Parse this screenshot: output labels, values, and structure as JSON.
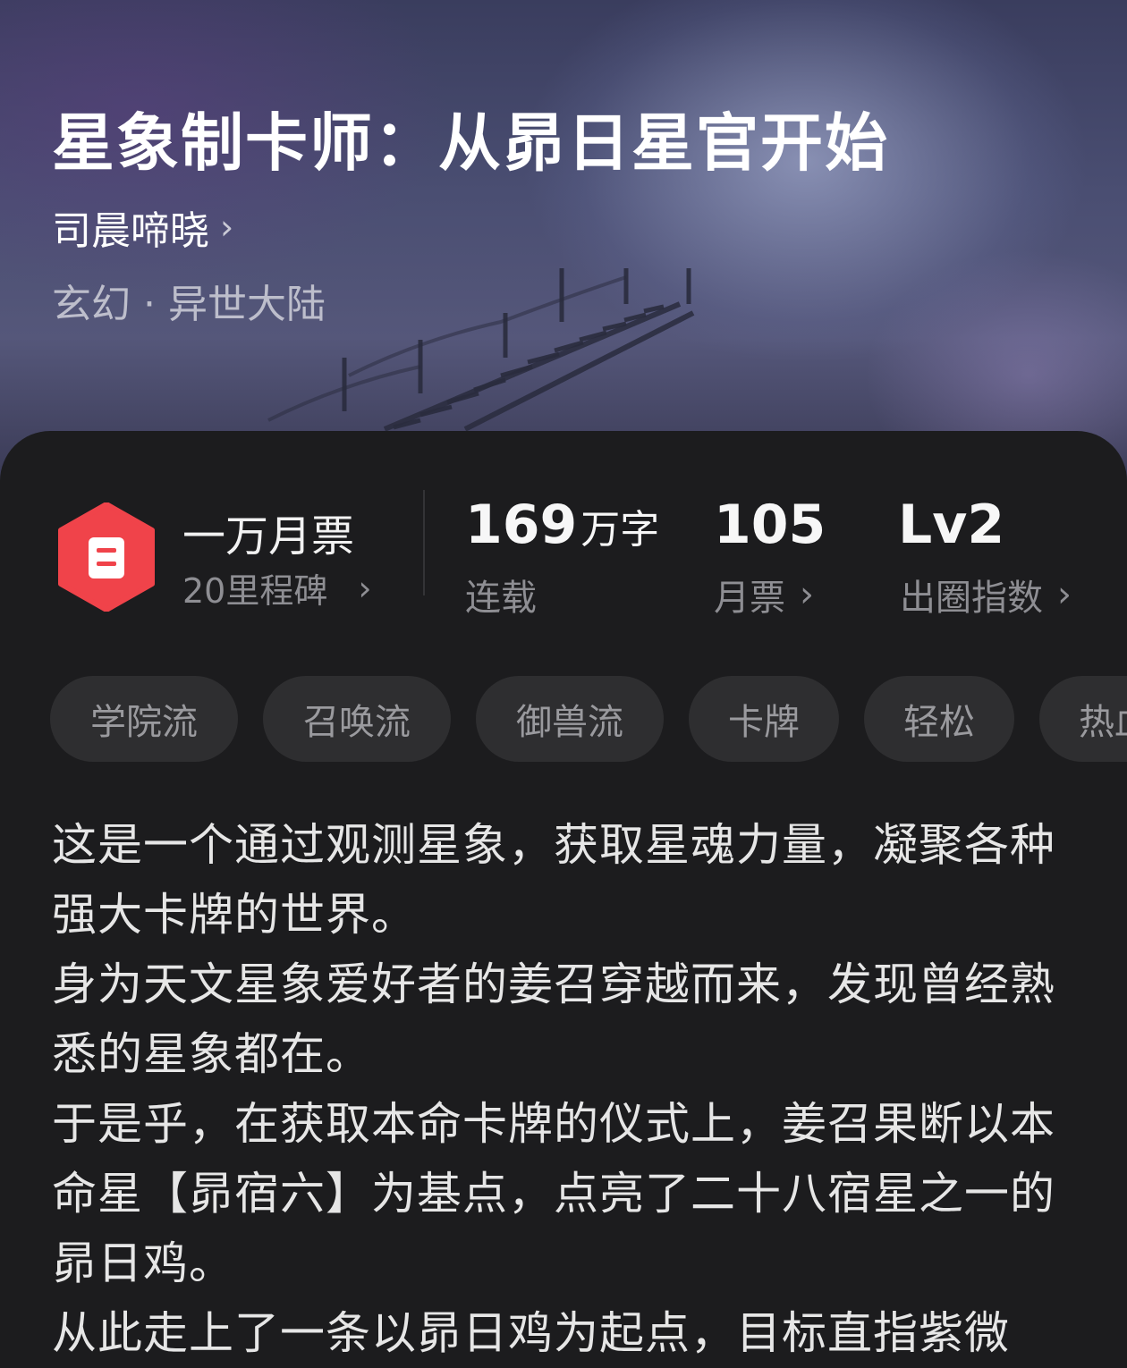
{
  "book": {
    "title": "星象制卡师：从昴日星官开始",
    "author": "司晨啼晓",
    "genre": "玄幻 · 异世大陆"
  },
  "ticket": {
    "title": "一万月票",
    "milestone": "20里程碑"
  },
  "stats": {
    "words_num": "169",
    "words_unit": "万字",
    "words_label": "连载",
    "votes_num": "105",
    "votes_label": "月票",
    "level_num": "Lv2",
    "level_label": "出圈指数"
  },
  "tags": [
    "学院流",
    "召唤流",
    "御兽流",
    "卡牌",
    "轻松",
    "热血"
  ],
  "description": [
    "这是一个通过观测星象，获取星魂力量，凝聚各种强大卡牌的世界。",
    "身为天文星象爱好者的姜召穿越而来，发现曾经熟悉的星象都在。",
    "于是乎，在获取本命卡牌的仪式上，姜召果断以本命星【昴宿六】为基点，点亮了二十八宿星之一的昴日鸡。",
    "从此走上了一条以昴日鸡为起点，目标直指紫微"
  ],
  "colors": {
    "panel_bg": "#1c1c1e",
    "badge_red": "#f0434a",
    "muted_text": "#8e8e93",
    "tag_bg": "#2e2e30"
  }
}
